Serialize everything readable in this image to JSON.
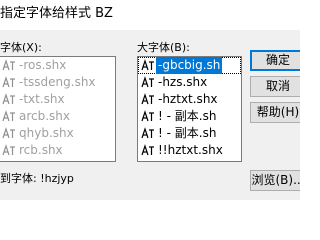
{
  "window": {
    "title": "指定字体给样式 BZ"
  },
  "small_font": {
    "label": "字体(X):",
    "items": [
      {
        "name": "-ros.shx",
        "icon": "shx-font-icon",
        "enabled": false
      },
      {
        "name": "-tssdeng.shx",
        "icon": "shx-font-icon",
        "enabled": false
      },
      {
        "name": "-txt.shx",
        "icon": "shx-font-icon",
        "enabled": false
      },
      {
        "name": "arcb.shx",
        "icon": "shx-font-icon",
        "enabled": false
      },
      {
        "name": "qhyb.shx",
        "icon": "shx-font-icon",
        "enabled": false
      },
      {
        "name": "rcb.shx",
        "icon": "shx-font-icon",
        "enabled": false
      }
    ]
  },
  "big_font": {
    "label": "大字体(B):",
    "items": [
      {
        "name": "-gbcbig.sh",
        "icon": "shx-font-icon",
        "selected": true
      },
      {
        "name": "-hzs.shx",
        "icon": "shx-font-icon",
        "selected": false
      },
      {
        "name": "-hztxt.shx",
        "icon": "shx-font-icon",
        "selected": false
      },
      {
        "name": "! - 副本.sh",
        "icon": "shx-font-icon",
        "selected": false
      },
      {
        "name": "! - 副本.sh",
        "icon": "shx-font-icon",
        "selected": false
      },
      {
        "name": "!!hztxt.shx",
        "icon": "shx-font-icon",
        "selected": false
      }
    ]
  },
  "buttons": {
    "ok": "确定",
    "cancel": "取消",
    "help": "帮助(H)",
    "browse": "浏览(B)..."
  },
  "status": {
    "mapped_font": "到字体: !hzjyp"
  },
  "colors": {
    "selection": "#0078d7",
    "dialog_bg": "#f0f0f0",
    "disabled_text": "#a0a0a0"
  }
}
